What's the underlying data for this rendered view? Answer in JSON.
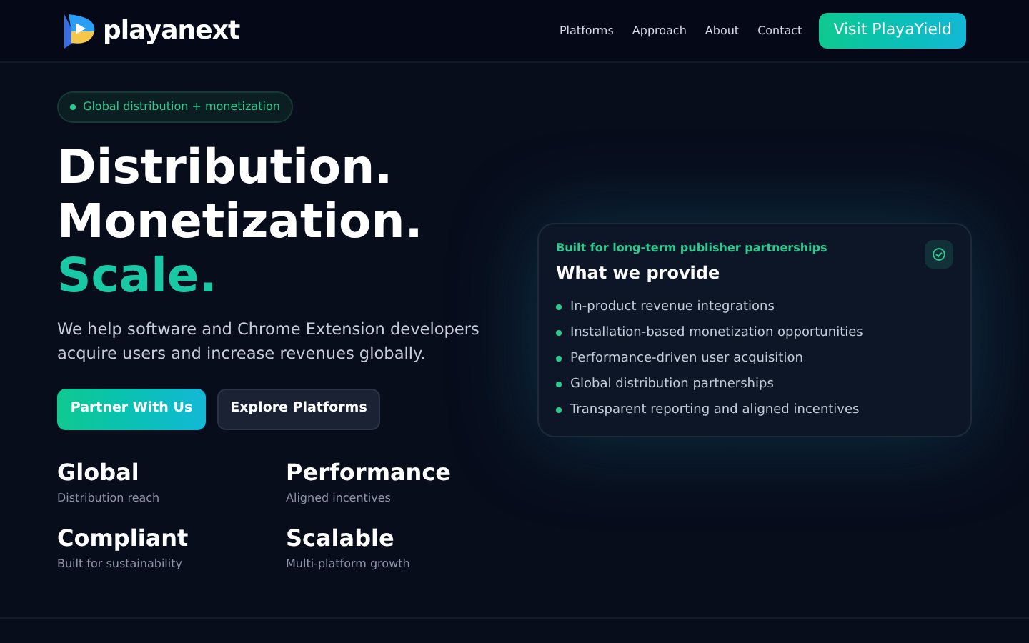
{
  "header": {
    "logo": "playanext",
    "nav": [
      "Platforms",
      "Approach",
      "About",
      "Contact"
    ],
    "cta": "Visit PlayaYield"
  },
  "hero": {
    "badge": "Global distribution + monetization",
    "headline": [
      "Distribution.",
      "Monetization.",
      "Scale."
    ],
    "lead": "We help software and Chrome Extension developers acquire users and increase revenues globally.",
    "buttons": [
      {
        "label": "Partner With Us",
        "kind": "primary"
      },
      {
        "label": "Explore Platforms",
        "kind": "secondary"
      }
    ],
    "stats": [
      {
        "title": "Global",
        "caption": "Distribution reach"
      },
      {
        "title": "Performance",
        "caption": "Aligned incentives"
      },
      {
        "title": "Compliant",
        "caption": "Built for sustainability"
      },
      {
        "title": "Scalable",
        "caption": "Multi-platform growth"
      }
    ]
  },
  "card": {
    "eyebrow": "Built for long-term publisher partnerships",
    "title": "What we provide",
    "items": [
      "In-product revenue integrations",
      "Installation-based monetization opportunities",
      "Performance-driven user acquisition",
      "Global distribution partnerships",
      "Transparent reporting and aligned incentives"
    ]
  }
}
